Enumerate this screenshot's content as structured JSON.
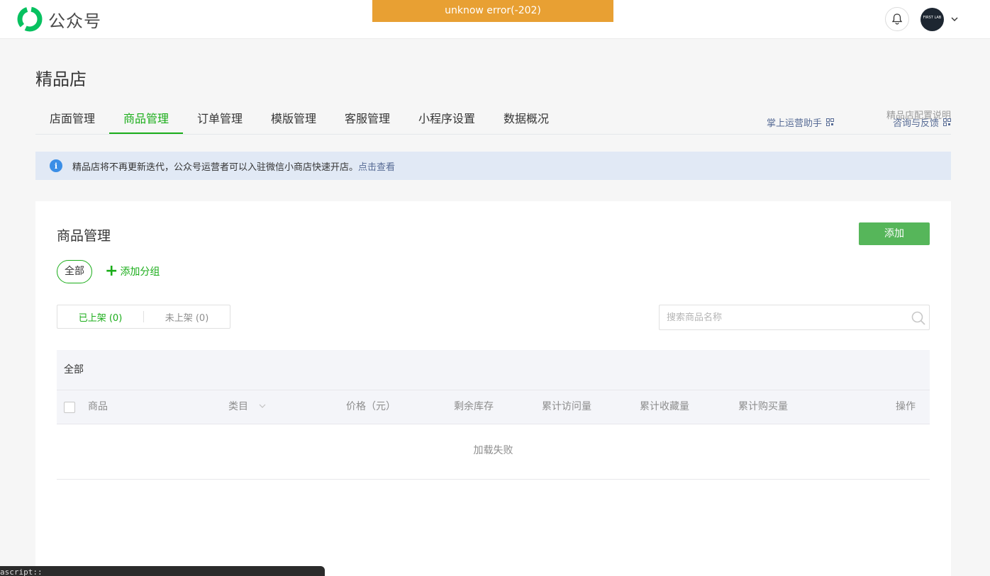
{
  "app": {
    "logo_text": "公众号",
    "error_banner": "unknow error(-202)",
    "avatar_text": "FIRST LAB"
  },
  "page": {
    "title": "精品店"
  },
  "tabs": [
    {
      "label": "店面管理"
    },
    {
      "label": "商品管理",
      "active": true
    },
    {
      "label": "订单管理"
    },
    {
      "label": "模版管理"
    },
    {
      "label": "客服管理"
    },
    {
      "label": "小程序设置"
    },
    {
      "label": "数据概况"
    }
  ],
  "side_links": {
    "config_doc": "精品店配置说明",
    "assistant": "掌上运营助手",
    "consult": "咨询与反馈"
  },
  "notice": {
    "text": "精品店将不再更新迭代，公众号运营者可以入驻微信小商店快速开店。",
    "link": "点击查看"
  },
  "panel": {
    "title": "商品管理",
    "add_button": "添加",
    "group_all": "全部",
    "add_group": "添加分组",
    "segments": [
      {
        "label": "已上架 (0)",
        "active": true
      },
      {
        "label": "未上架 (0)"
      }
    ],
    "search_placeholder": "搜索商品名称",
    "group_header": "全部",
    "columns": [
      "商品",
      "类目",
      "价格（元）",
      "剩余库存",
      "累计访问量",
      "累计收藏量",
      "累计购买量",
      "操作"
    ],
    "empty_text": "加载失败"
  },
  "dev_strip": "ascript::",
  "colors": {
    "accent": "#1aad19",
    "error_banner": "#e8a033",
    "link": "#576b95",
    "notice_bg": "#e1e9f5"
  }
}
